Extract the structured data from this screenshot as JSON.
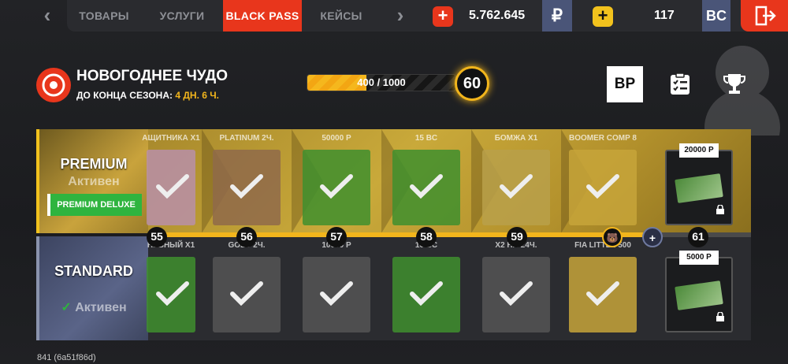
{
  "topbar": {
    "tabs": [
      "ТОВАРЫ",
      "УСЛУГИ",
      "BLACK PASS",
      "КЕЙСЫ"
    ],
    "active_tab": "BLACK PASS",
    "rub_value": "5.762.645",
    "rub_symbol": "₽",
    "bc_value": "117",
    "bc_label": "BC"
  },
  "season": {
    "title": "НОВОГОДНЕЕ ЧУДО",
    "ends_prefix": "ДО КОНЦА СЕЗОНА:",
    "ends_time": "4 ДН. 6 Ч.",
    "progress_text": "400 / 1000",
    "progress_fraction": 0.4,
    "level": "60",
    "bp_label": "BP"
  },
  "passes": {
    "premium": {
      "name": "PREMIUM",
      "status": "Активен",
      "deluxe": "PREMIUM DELUXE"
    },
    "standard": {
      "name": "STANDARD",
      "status": "Активен"
    }
  },
  "levels": [
    "55",
    "56",
    "57",
    "58",
    "59",
    "",
    "",
    "61"
  ],
  "premium_items": [
    {
      "label": "АЩИТНИКА X1",
      "claimed": true
    },
    {
      "label": "PLATINUM 2Ч.",
      "claimed": true
    },
    {
      "label": "50000 Р",
      "claimed": true
    },
    {
      "label": "15 BC",
      "claimed": true
    },
    {
      "label": "БОМЖА X1",
      "claimed": true
    },
    {
      "label": "BOOMER COMP 8",
      "claimed": true
    },
    {
      "label": "20000 Р",
      "claimed": false
    }
  ],
  "standard_items": [
    {
      "label": "НЕВНЫЙ X1",
      "claimed": true
    },
    {
      "label": "GOLD 2Ч.",
      "claimed": true
    },
    {
      "label": "10000 Р",
      "claimed": true
    },
    {
      "label": "10 BC",
      "claimed": true
    },
    {
      "label": "X2 НА 24Ч.",
      "claimed": true
    },
    {
      "label": "FIA LITTLE 500",
      "claimed": true
    },
    {
      "label": "5000 Р",
      "claimed": false
    }
  ],
  "build_info": "841 (6a51f86d)",
  "colors": {
    "accent": "#e8361c",
    "gold": "#f2b51c",
    "green": "#2fb43f"
  }
}
